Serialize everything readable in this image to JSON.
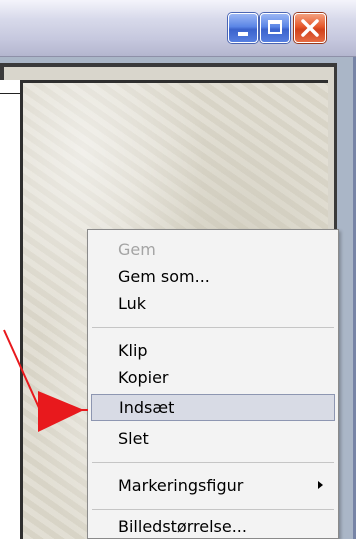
{
  "window": {
    "controls": {
      "minimize": "minimize-icon",
      "maximize": "maximize-icon",
      "close": "close-icon"
    },
    "close_color": "#e6582b",
    "button_color": "#3b63cc"
  },
  "context_menu": {
    "items": [
      {
        "label": "Gem",
        "enabled": false
      },
      {
        "label": "Gem som...",
        "enabled": true
      },
      {
        "label": "Luk",
        "enabled": true
      },
      {
        "label": "Klip",
        "enabled": true
      },
      {
        "label": "Kopier",
        "enabled": true
      },
      {
        "label": "Indsæt",
        "enabled": true,
        "highlighted": true
      },
      {
        "label": "Slet",
        "enabled": true
      },
      {
        "label": "Markeringsfigur",
        "enabled": true,
        "submenu": true
      },
      {
        "label": "Billedstørrelse...",
        "enabled": true
      }
    ],
    "highlight_color": "#d8dbe5"
  },
  "annotation": {
    "type": "arrow",
    "color": "#e8191d",
    "points_to": "Indsæt"
  }
}
